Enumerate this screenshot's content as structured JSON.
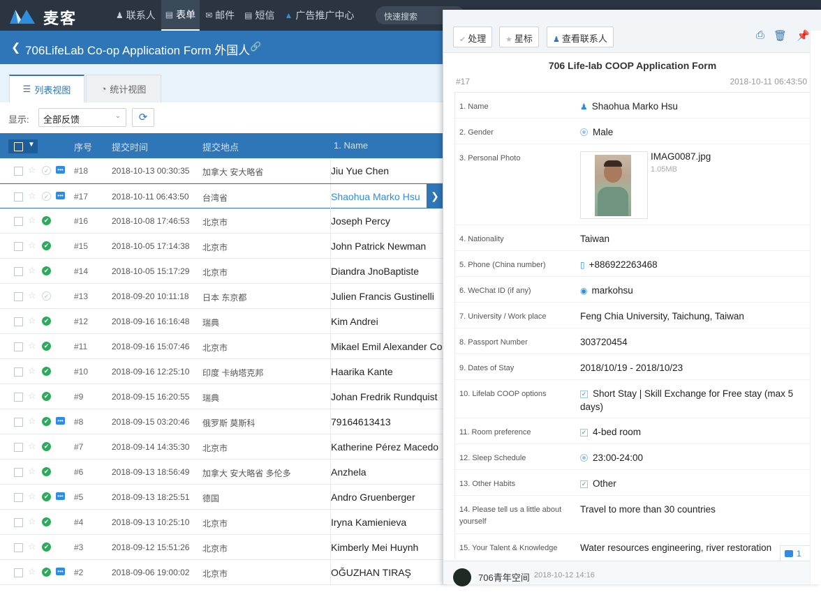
{
  "app": {
    "name": "麦客",
    "search_placeholder": "快速搜索"
  },
  "nav": [
    {
      "label": "联系人",
      "icon": "contacts-icon",
      "active": false
    },
    {
      "label": "表单",
      "icon": "form-icon",
      "active": true
    },
    {
      "label": "邮件",
      "icon": "mail-icon",
      "active": false
    },
    {
      "label": "短信",
      "icon": "sms-icon",
      "active": false
    },
    {
      "label": "广告推广中心",
      "icon": "ads-icon",
      "active": false
    }
  ],
  "form": {
    "title": "706LifeLab Co-op Application Form 外国人",
    "link_icon": "link-icon"
  },
  "tabs": [
    {
      "label": "列表视图",
      "active": true
    },
    {
      "label": "统计视图",
      "active": false
    }
  ],
  "filter": {
    "label": "显示:",
    "value": "全部反馈"
  },
  "table": {
    "headers": [
      "序号",
      "提交时间",
      "提交地点",
      "1. Name"
    ],
    "rows": [
      {
        "seq": "#18",
        "time": "2018-10-13 00:30:35",
        "location": "加拿大 安大略省",
        "name": "Jiu Yue Chen",
        "status": "todo",
        "comment": true,
        "selected": false
      },
      {
        "seq": "#17",
        "time": "2018-10-11 06:43:50",
        "location": "台湾省",
        "name": "Shaohua Marko Hsu",
        "status": "todo",
        "comment": true,
        "selected": true
      },
      {
        "seq": "#16",
        "time": "2018-10-08 17:46:53",
        "location": "北京市",
        "name": "Joseph Percy",
        "status": "done",
        "comment": false,
        "selected": false
      },
      {
        "seq": "#15",
        "time": "2018-10-05 17:14:38",
        "location": "北京市",
        "name": "John Patrick Newman",
        "status": "done",
        "comment": false,
        "selected": false
      },
      {
        "seq": "#14",
        "time": "2018-10-05 15:17:29",
        "location": "北京市",
        "name": "Diandra JnoBaptiste",
        "status": "done",
        "comment": false,
        "selected": false
      },
      {
        "seq": "#13",
        "time": "2018-09-20 10:11:18",
        "location": "日本 东京都",
        "name": "Julien Francis Gustinelli",
        "status": "todo",
        "comment": false,
        "selected": false
      },
      {
        "seq": "#12",
        "time": "2018-09-16 16:16:48",
        "location": "瑞典",
        "name": "Kim Andrei",
        "status": "done",
        "comment": false,
        "selected": false
      },
      {
        "seq": "#11",
        "time": "2018-09-16 15:07:46",
        "location": "北京市",
        "name": "Mikael Emil Alexander Con",
        "status": "done",
        "comment": false,
        "selected": false
      },
      {
        "seq": "#10",
        "time": "2018-09-16 12:25:10",
        "location": "印度 卡纳塔克邦",
        "name": "Haarika Kante",
        "status": "done",
        "comment": false,
        "selected": false
      },
      {
        "seq": "#9",
        "time": "2018-09-15 16:20:55",
        "location": "瑞典",
        "name": "Johan Fredrik Rundquist",
        "status": "done",
        "comment": false,
        "selected": false
      },
      {
        "seq": "#8",
        "time": "2018-09-15 03:20:46",
        "location": "俄罗斯 莫斯科",
        "name": "79164613413",
        "status": "done",
        "comment": true,
        "selected": false
      },
      {
        "seq": "#7",
        "time": "2018-09-14 14:35:30",
        "location": "北京市",
        "name": "Katherine Pérez Macedo",
        "status": "done",
        "comment": false,
        "selected": false
      },
      {
        "seq": "#6",
        "time": "2018-09-13 18:56:49",
        "location": "加拿大 安大略省 多伦多",
        "name": "Anzhela",
        "status": "done",
        "comment": false,
        "selected": false
      },
      {
        "seq": "#5",
        "time": "2018-09-13 18:25:51",
        "location": "德国",
        "name": "Andro Gruenberger",
        "status": "done",
        "comment": true,
        "selected": false
      },
      {
        "seq": "#4",
        "time": "2018-09-13 10:25:10",
        "location": "北京市",
        "name": "Iryna Kamienieva",
        "status": "done",
        "comment": false,
        "selected": false
      },
      {
        "seq": "#3",
        "time": "2018-09-12 15:51:26",
        "location": "北京市",
        "name": "Kimberly Mei Huynh",
        "status": "done",
        "comment": false,
        "selected": false
      },
      {
        "seq": "#2",
        "time": "2018-09-06 19:00:02",
        "location": "北京市",
        "name": "OĞUZHAN TIRAŞ",
        "status": "done",
        "comment": true,
        "selected": false
      }
    ]
  },
  "detail": {
    "buttons": {
      "process": "处理",
      "star": "星标",
      "view_contact": "查看联系人"
    },
    "title": "706 Life-lab COOP Application Form",
    "number": "#17",
    "date": "2018-10-11 06:43:50",
    "fields": [
      {
        "label": "1. Name",
        "value": "Shaohua Marko Hsu",
        "icon": "person-icon"
      },
      {
        "label": "2. Gender",
        "value": "Male",
        "icon": "radio"
      },
      {
        "label": "3. Personal Photo",
        "file": "IMAG0087.jpg",
        "size": "1.05MB"
      },
      {
        "label": "4. Nationality",
        "value": "Taiwan"
      },
      {
        "label": "5. Phone (China number)",
        "value": "+886922263468",
        "icon": "phone-icon"
      },
      {
        "label": "6. WeChat ID (if any)",
        "value": "markohsu",
        "icon": "wechat-icon"
      },
      {
        "label": "7. University / Work place",
        "value": "Feng Chia University, Taichung, Taiwan"
      },
      {
        "label": "8. Passport Number",
        "value": "303720454"
      },
      {
        "label": "9. Dates of Stay",
        "value": "2018/10/19 - 2018/10/23"
      },
      {
        "label": "10. Lifelab COOP options",
        "value": "Short Stay | Skill Exchange for Free stay (max 5 days)",
        "icon": "checkbox"
      },
      {
        "label": "11. Room preference",
        "value": "4-bed room",
        "icon": "checkbox"
      },
      {
        "label": "12. Sleep Schedule",
        "value": "23:00-24:00",
        "icon": "radio"
      },
      {
        "label": "13. Other Habits",
        "value": "Other",
        "icon": "checkbox"
      },
      {
        "label": "14. Please tell us a little about yourself",
        "value": "Travel to more than 30 countries"
      },
      {
        "label": "15. Your Talent & Knowledge",
        "value": "Water resources engineering, river restoration"
      }
    ],
    "comment_count": "1",
    "comment": {
      "author": "706青年空间",
      "time": "2018-10-12 14:16"
    }
  },
  "colors": {
    "topbar": "#2a3541",
    "primary": "#2f76b9",
    "done": "#2eaa5c"
  }
}
